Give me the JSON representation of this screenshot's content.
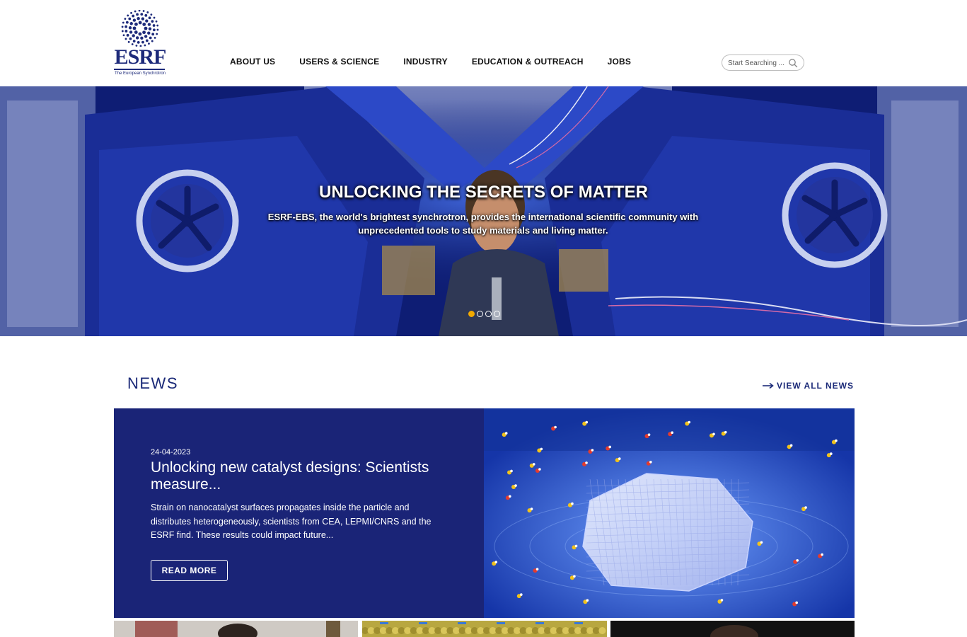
{
  "header": {
    "logo": {
      "wordmark": "ESRF",
      "tagline": "The European Synchrotron"
    },
    "nav": [
      {
        "label": "ABOUT US"
      },
      {
        "label": "USERS & SCIENCE"
      },
      {
        "label": "INDUSTRY"
      },
      {
        "label": "EDUCATION & OUTREACH"
      },
      {
        "label": "JOBS"
      }
    ],
    "search": {
      "placeholder": "Start Searching ...",
      "icon": "search-icon"
    }
  },
  "hero": {
    "title": "UNLOCKING THE SECRETS OF MATTER",
    "subtitle": "ESRF-EBS, the world's brightest synchrotron, provides the international scientific community with unprecedented tools to study materials and living matter.",
    "slide_count": 4,
    "active_slide": 1,
    "active_dot_color": "#f2a900"
  },
  "news": {
    "heading": "NEWS",
    "view_all": "VIEW ALL NEWS",
    "featured": {
      "date": "24-04-2023",
      "title": "Unlocking new catalyst designs: Scientists measure...",
      "description": "Strain on nanocatalyst surfaces propagates inside the particle and distributes heterogeneously, scientists from CEA, LEPMI/CNRS and the ESRF find. These results could impact future...",
      "button": "READ MORE"
    }
  },
  "colors": {
    "brand_navy": "#1b2a78",
    "feature_bg": "#1a2477",
    "accent": "#f2a900"
  }
}
